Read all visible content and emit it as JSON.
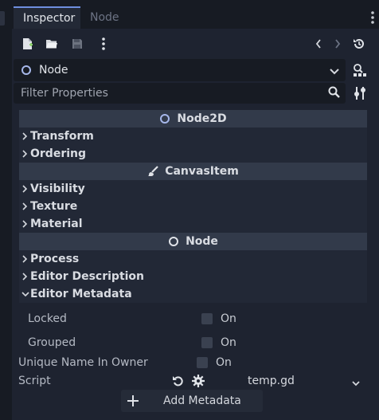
{
  "tabs": [
    {
      "label": "Inspector",
      "active": true
    },
    {
      "label": "Node",
      "active": false
    }
  ],
  "toolbar": {
    "icons": [
      "new-resource-icon",
      "open-folder-icon",
      "save-icon",
      "more-icon",
      "back-icon",
      "forward-icon",
      "history-icon"
    ]
  },
  "node_selector": {
    "value": "Node",
    "icon": "node-ring-icon"
  },
  "filter": {
    "placeholder": "Filter Properties"
  },
  "categories": {
    "node2d": "Node2D",
    "canvas_item": "CanvasItem",
    "node": "Node"
  },
  "sections": {
    "transform": "Transform",
    "ordering": "Ordering",
    "visibility": "Visibility",
    "texture": "Texture",
    "material": "Material",
    "process": "Process",
    "editor_description": "Editor Description",
    "editor_metadata": "Editor Metadata"
  },
  "properties": {
    "locked": {
      "label": "Locked",
      "value": "On",
      "checked": false
    },
    "grouped": {
      "label": "Grouped",
      "value": "On",
      "checked": false
    },
    "unique_name": {
      "label": "Unique Name In Owner",
      "value": "On",
      "checked": false
    },
    "script": {
      "label": "Script",
      "value": "temp.gd"
    }
  },
  "add_metadata_label": "Add Metadata",
  "colors": {
    "node_ring": "#a6b7ea",
    "active_tab_accent": "#6e8ede",
    "category_bg": "#323a4a",
    "panel_bg": "#1e2330"
  }
}
